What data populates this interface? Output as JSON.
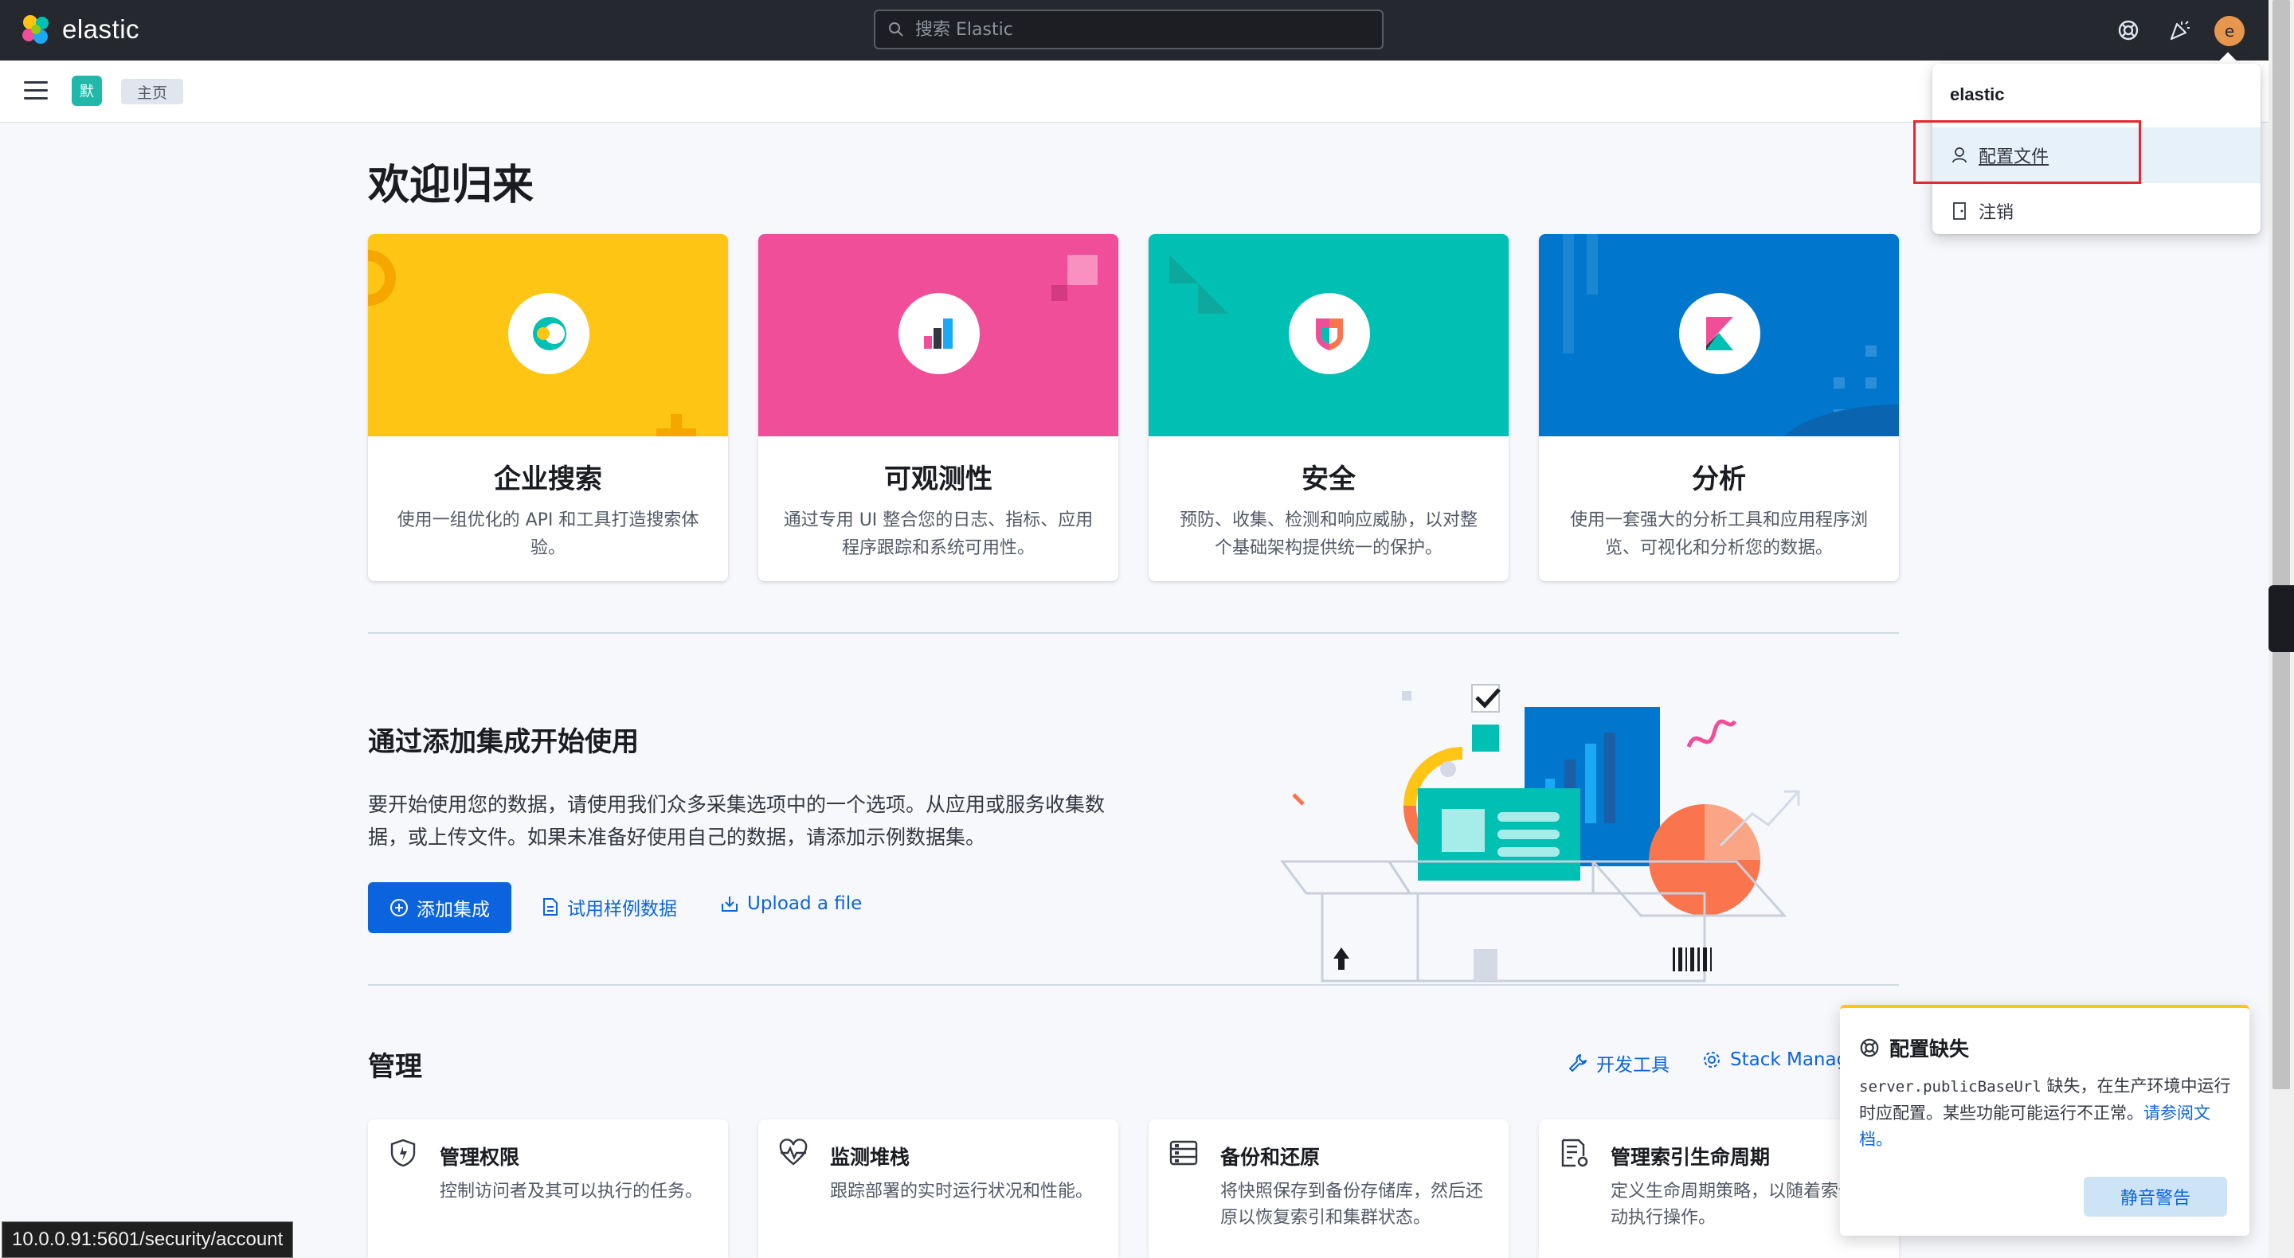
{
  "topbar": {
    "brand": "elastic",
    "search_placeholder": "搜索 Elastic",
    "avatar_initial": "e"
  },
  "subbar": {
    "space_initial": "默",
    "breadcrumb": "主页"
  },
  "main": {
    "title": "欢迎归来",
    "solutions": [
      {
        "title": "企业搜索",
        "desc": "使用一组优化的 API 和工具打造搜索体验。",
        "color": "#fec514"
      },
      {
        "title": "可观测性",
        "desc": "通过专用 UI 整合您的日志、指标、应用程序跟踪和系统可用性。",
        "color": "#f04e98"
      },
      {
        "title": "安全",
        "desc": "预防、收集、检测和响应威胁，以对整个基础架构提供统一的保护。",
        "color": "#00bfb3"
      },
      {
        "title": "分析",
        "desc": "使用一套强大的分析工具和应用程序浏览、可视化和分析您的数据。",
        "color": "#0077cc"
      }
    ],
    "integrations": {
      "title": "通过添加集成开始使用",
      "desc": "要开始使用您的数据，请使用我们众多采集选项中的一个选项。从应用或服务收集数据，或上传文件。如果未准备好使用自己的数据，请添加示例数据集。",
      "add_button": "添加集成",
      "sample_link": "试用样例数据",
      "upload_link": "Upload a file"
    },
    "management": {
      "title": "管理",
      "dev_tools": "开发工具",
      "stack_management": "Stack Manag",
      "cards": [
        {
          "title": "管理权限",
          "desc": "控制访问者及其可以执行的任务。"
        },
        {
          "title": "监测堆栈",
          "desc": "跟踪部署的实时运行状况和性能。"
        },
        {
          "title": "备份和还原",
          "desc": "将快照保存到备份存储库，然后还原以恢复索引和集群状态。"
        },
        {
          "title": "管理索引生命周期",
          "desc": "定义生命周期策略，以随着索化自动执行操作。"
        }
      ]
    }
  },
  "user_menu": {
    "username": "elastic",
    "profile": "配置文件",
    "logout": "注销"
  },
  "toast": {
    "title": "配置缺失",
    "code": "server.publicBaseUrl",
    "body": " 缺失，在生产环境中运行时应配置。某些功能可能运行不正常。",
    "link": "请参阅文档。",
    "button": "静音警告"
  },
  "status_url": "10.0.0.91:5601/security/account"
}
